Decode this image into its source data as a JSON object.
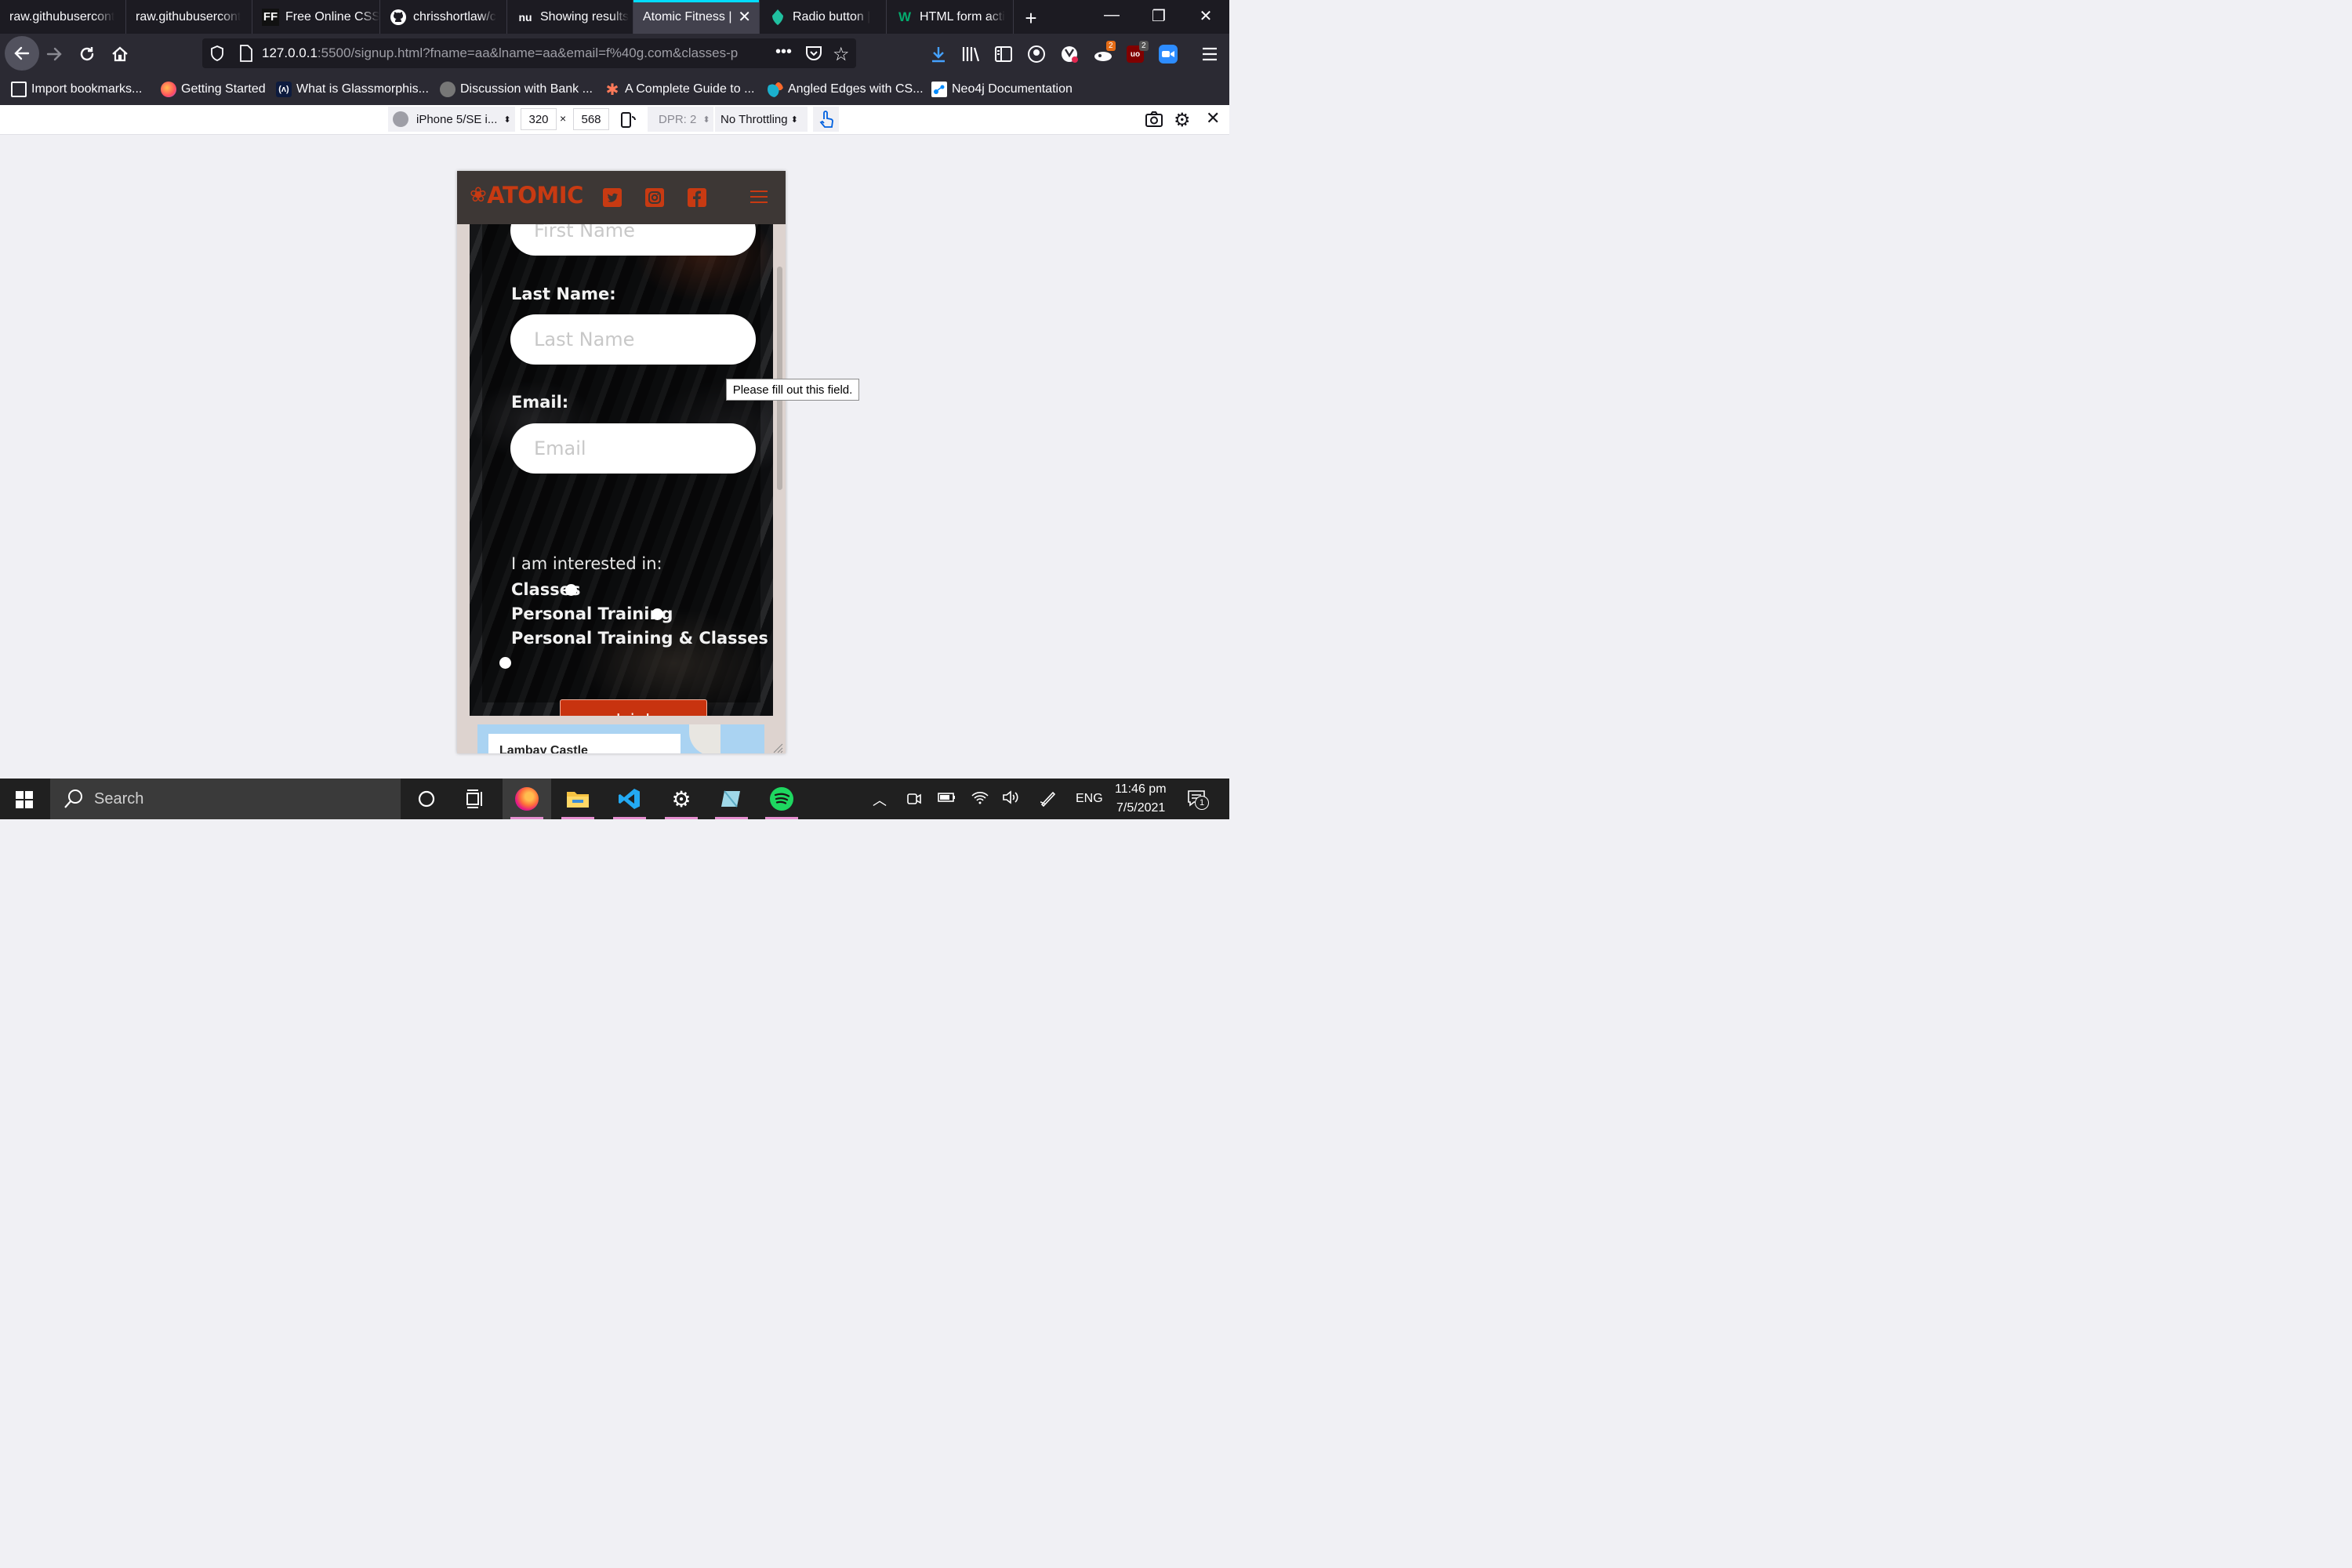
{
  "browser": {
    "tabs": [
      {
        "title": "raw.githubusercont",
        "icon": "none"
      },
      {
        "title": "raw.githubusercont",
        "icon": "none"
      },
      {
        "title": "Free Online CSS",
        "icon": "ff-icon"
      },
      {
        "title": "chrisshortlaw/c",
        "icon": "github-icon"
      },
      {
        "title": "Showing results",
        "icon": "nu-icon"
      },
      {
        "title": "Atomic Fitness |",
        "icon": "none",
        "active": true
      },
      {
        "title": "Radio button |",
        "icon": "codrops-icon"
      },
      {
        "title": "HTML form acti",
        "icon": "w3-icon"
      }
    ],
    "tab_icon_text": {
      "ff": "FF",
      "nu": "nu",
      "w3": "W"
    },
    "url_host": "127.0.0.1",
    "url_rest": ":5500/signup.html?fname=aa&lname=aa&email=f%40g.com&classes-p",
    "toolbar_badges": {
      "extension_a": "2",
      "ublock": "2"
    },
    "ublock_text": "uo",
    "bookmarks": [
      {
        "label": "Import bookmarks..."
      },
      {
        "label": "Getting Started"
      },
      {
        "label": "What is Glassmorphis..."
      },
      {
        "label": "Discussion with Bank ..."
      },
      {
        "label": "A Complete Guide to ..."
      },
      {
        "label": "Angled Edges with CS..."
      },
      {
        "label": "Neo4j Documentation"
      }
    ],
    "bookmark_icon_text": "(ʌ)"
  },
  "rdm": {
    "device": "iPhone 5/SE i...",
    "width": "320",
    "times": "×",
    "height": "568",
    "dpr": "DPR: 2",
    "throttling": "No Throttling"
  },
  "site": {
    "logo": "ATOMIC",
    "logo_glyph": "❀",
    "form": {
      "first_name_placeholder": "First Name",
      "last_name_label": "Last Name:",
      "last_name_placeholder": "Last Name",
      "email_label": "Email:",
      "email_placeholder": "Email",
      "interest_title": "I am interested in:",
      "options": [
        "Classes",
        "Personal Training",
        "Personal Training & Classes"
      ],
      "join_label": "Join!"
    },
    "map_title": "Lambay Castle",
    "tooltip": "Please fill out this field."
  },
  "taskbar": {
    "search_placeholder": "Search",
    "language": "ENG",
    "time": "11:46 pm",
    "date": "7/5/2021",
    "notification_count": "1"
  },
  "colors": {
    "brand_red": "#c83a12",
    "header_bg": "#3d3735",
    "join_bg": "#c8330f",
    "active_tab_accent": "#00ddff"
  }
}
